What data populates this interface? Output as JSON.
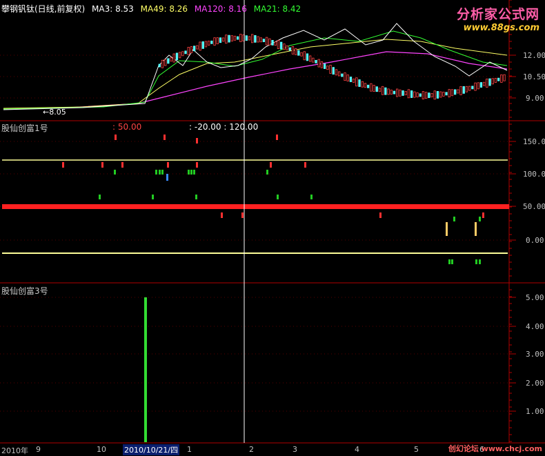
{
  "header": {
    "stock_name": "攀钢钒钛(日线,前复权)",
    "ma3": "MA3: 8.53",
    "ma49": "MA49: 8.26",
    "ma120": "MA120: 8.16",
    "ma21": "MA21: 8.42",
    "low_marker": "←8.05",
    "colors": {
      "ma3": "#ffffff",
      "ma49": "#ffff66",
      "ma120": "#ff44ff",
      "ma21": "#33ff33"
    }
  },
  "logo": {
    "text": "分析家公式网",
    "url": "www.88gs.com"
  },
  "price_axis": [
    "12.00",
    "10.50",
    "9.00"
  ],
  "indicator1": {
    "name": "股仙创富1号",
    "values": ": 50.00",
    "values2": ": -20.00  : 120.00",
    "axis": [
      "150.0",
      "100.0",
      "50.00",
      "0.00"
    ]
  },
  "indicator3": {
    "name": "股仙创富3号",
    "axis": [
      "5.00",
      "4.00",
      "3.00",
      "2.00",
      "1.00"
    ]
  },
  "x_axis": {
    "year": "2010年",
    "months": [
      "9",
      "10",
      "1",
      "2",
      "3",
      "4",
      "5",
      "6"
    ],
    "cursor_date": "2010/10/21/四"
  },
  "watermark": "创幻论坛 www.chcj.com"
}
